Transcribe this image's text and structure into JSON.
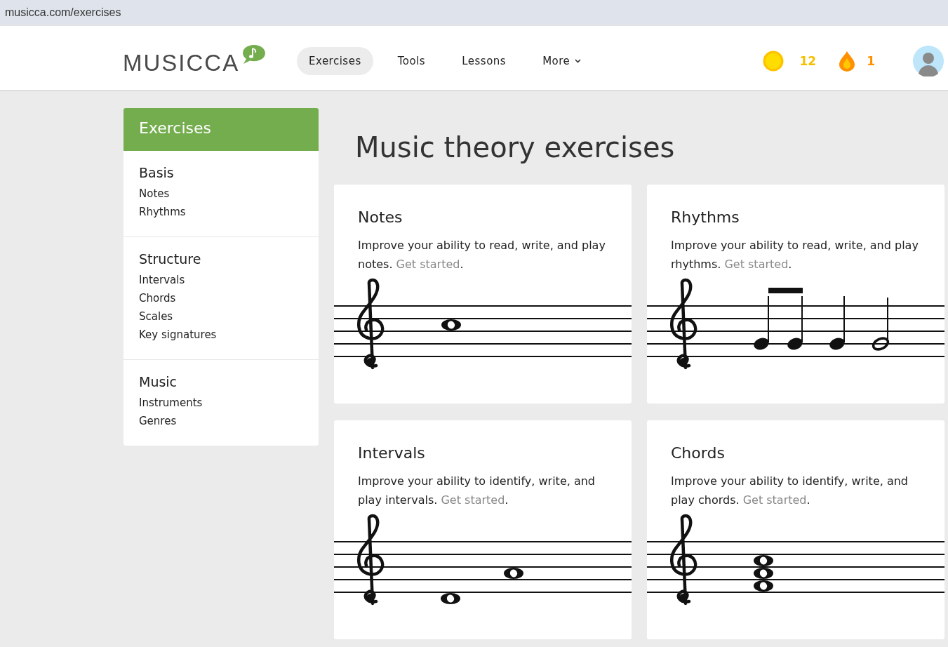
{
  "address_bar": {
    "url": "musicca.com/exercises"
  },
  "header": {
    "logo": "MUSICCA",
    "nav": [
      {
        "label": "Exercises",
        "selected": true,
        "dropdown": false
      },
      {
        "label": "Tools",
        "selected": false,
        "dropdown": false
      },
      {
        "label": "Lessons",
        "selected": false,
        "dropdown": false
      },
      {
        "label": "More",
        "selected": false,
        "dropdown": true
      }
    ],
    "coins": "12",
    "streak": "1"
  },
  "sidebar": {
    "title": "Exercises",
    "groups": [
      {
        "heading": "Basis",
        "items": [
          "Notes",
          "Rhythms"
        ]
      },
      {
        "heading": "Structure",
        "items": [
          "Intervals",
          "Chords",
          "Scales",
          "Key signatures"
        ]
      },
      {
        "heading": "Music",
        "items": [
          "Instruments",
          "Genres"
        ]
      }
    ]
  },
  "main": {
    "title": "Music theory exercises",
    "cards": [
      {
        "title": "Notes",
        "description": "Improve your ability to read, write, and play notes.",
        "link": "Get started",
        "end": ".",
        "kind": "single"
      },
      {
        "title": "Rhythms",
        "description": "Improve your ability to read, write, and play rhythms.",
        "link": "Get started",
        "end": ".",
        "kind": "rhythm"
      },
      {
        "title": "Intervals",
        "description": "Improve your ability to identify, write, and play intervals.",
        "link": "Get started",
        "end": ".",
        "kind": "interval"
      },
      {
        "title": "Chords",
        "description": "Improve your ability to identify, write, and play chords.",
        "link": "Get started",
        "end": ".",
        "kind": "chord"
      }
    ]
  }
}
